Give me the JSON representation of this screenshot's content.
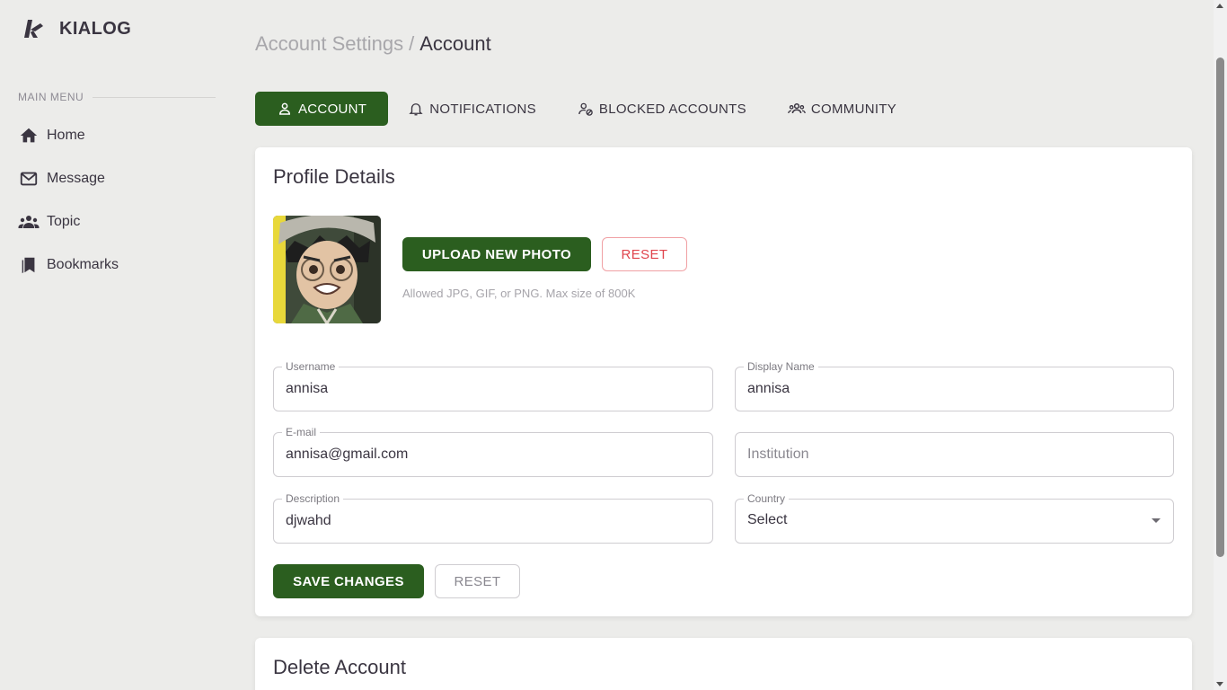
{
  "brand": {
    "name": "KIALOG",
    "logo_letter": "k"
  },
  "sidebar": {
    "section_label": "MAIN MENU",
    "items": [
      {
        "label": "Home",
        "icon": "home-icon"
      },
      {
        "label": "Message",
        "icon": "mail-icon"
      },
      {
        "label": "Topic",
        "icon": "group-icon"
      },
      {
        "label": "Bookmarks",
        "icon": "bookmarks-icon"
      }
    ]
  },
  "breadcrumb": {
    "parent": "Account Settings",
    "separator": "/",
    "current": "Account"
  },
  "tabs": [
    {
      "label": "ACCOUNT",
      "icon": "user-icon",
      "active": true
    },
    {
      "label": "NOTIFICATIONS",
      "icon": "bell-icon",
      "active": false
    },
    {
      "label": "BLOCKED ACCOUNTS",
      "icon": "user-blocked-icon",
      "active": false
    },
    {
      "label": "COMMUNITY",
      "icon": "community-icon",
      "active": false
    }
  ],
  "profile": {
    "title": "Profile Details",
    "upload_label": "UPLOAD NEW PHOTO",
    "reset_photo_label": "RESET",
    "hint": "Allowed JPG, GIF, or PNG. Max size of 800K",
    "fields": {
      "username": {
        "label": "Username",
        "value": "annisa"
      },
      "display_name": {
        "label": "Display Name",
        "value": "annisa"
      },
      "email": {
        "label": "E-mail",
        "value": "annisa@gmail.com"
      },
      "institution": {
        "label": "",
        "placeholder": "Institution",
        "value": ""
      },
      "description": {
        "label": "Description",
        "value": "djwahd"
      },
      "country": {
        "label": "Country",
        "value": "Select"
      }
    },
    "save_label": "SAVE CHANGES",
    "reset_label": "RESET"
  },
  "delete_account": {
    "title": "Delete Account"
  },
  "colors": {
    "primary": "#2b5e1f",
    "danger": "#e0454d",
    "background": "#ececea"
  }
}
